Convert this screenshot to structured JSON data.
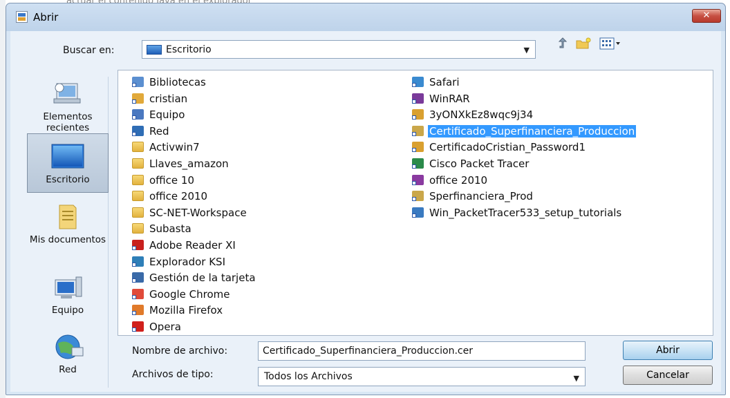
{
  "background": {
    "text": "actuar el contenido Java en el explorador"
  },
  "window": {
    "title": "Abrir",
    "close_label": "✕"
  },
  "toolbar": {
    "lookin_label": "Buscar en:",
    "lookin_value": "Escritorio",
    "up_icon": "up-folder-icon",
    "new_folder_icon": "new-folder-icon",
    "view_icon": "view-menu-icon"
  },
  "places": [
    {
      "label": "Elementos recientes",
      "icon": "recent-items-icon"
    },
    {
      "label": "Escritorio",
      "icon": "desktop-icon",
      "selected": true
    },
    {
      "label": "Mis documentos",
      "icon": "documents-icon"
    },
    {
      "label": "Equipo",
      "icon": "computer-icon"
    },
    {
      "label": "Red",
      "icon": "network-icon"
    }
  ],
  "files_col1": [
    {
      "name": "Bibliotecas",
      "icon": "libraries-icon",
      "color": "#5b8fd0"
    },
    {
      "name": "cristian",
      "icon": "user-folder-icon",
      "color": "#e1a93a"
    },
    {
      "name": "Equipo",
      "icon": "computer-icon",
      "color": "#4a78c0"
    },
    {
      "name": "Red",
      "icon": "network-icon",
      "color": "#2f6db5"
    },
    {
      "name": "Activwin7",
      "icon": "folder-icon",
      "color": "#e8c25a"
    },
    {
      "name": "Llaves_amazon",
      "icon": "folder-icon",
      "color": "#e8c25a"
    },
    {
      "name": "office 10",
      "icon": "folder-icon",
      "color": "#e8c25a"
    },
    {
      "name": "office 2010",
      "icon": "folder-icon",
      "color": "#e8c25a"
    },
    {
      "name": "SC-NET-Workspace",
      "icon": "folder-icon",
      "color": "#e8c25a"
    },
    {
      "name": "Subasta",
      "icon": "folder-icon",
      "color": "#e8c25a"
    },
    {
      "name": "Adobe Reader XI",
      "icon": "adobe-reader-icon",
      "color": "#c8201e"
    },
    {
      "name": "Explorador KSI",
      "icon": "ksi-explorer-icon",
      "color": "#2e7fb8"
    },
    {
      "name": "Gestión de la tarjeta",
      "icon": "card-manager-icon",
      "color": "#3a6aa8"
    },
    {
      "name": "Google Chrome",
      "icon": "chrome-icon",
      "color": "#e04a3a"
    },
    {
      "name": "Mozilla Firefox",
      "icon": "firefox-icon",
      "color": "#e07a2a"
    },
    {
      "name": "Opera",
      "icon": "opera-icon",
      "color": "#d0201c"
    }
  ],
  "files_col2": [
    {
      "name": "Safari",
      "icon": "safari-icon",
      "color": "#3a8ad0"
    },
    {
      "name": "WinRAR",
      "icon": "winrar-icon",
      "color": "#7a3a9a"
    },
    {
      "name": "3yONXkEz8wqc9j34",
      "icon": "certificate-file-icon",
      "color": "#d9a030"
    },
    {
      "name": "Certificado_Superfinanciera_Produccion",
      "icon": "certificate-icon",
      "color": "#caa74a",
      "selected": true
    },
    {
      "name": "CertificadoCristian_Password1",
      "icon": "certificate-file-icon",
      "color": "#d9a030"
    },
    {
      "name": "Cisco Packet Tracer",
      "icon": "cisco-packet-tracer-icon",
      "color": "#2a8a4a"
    },
    {
      "name": "office 2010",
      "icon": "archive-icon",
      "color": "#8a3aa0"
    },
    {
      "name": "Sperfinanciera_Prod",
      "icon": "certificate-icon",
      "color": "#caa74a"
    },
    {
      "name": "Win_PacketTracer533_setup_tutorials",
      "icon": "installer-icon",
      "color": "#3a7ac0"
    }
  ],
  "filename": {
    "label": "Nombre de archivo:",
    "value": "Certificado_Superfinanciera_Produccion.cer"
  },
  "filetype": {
    "label": "Archivos de tipo:",
    "value": "Todos los Archivos"
  },
  "buttons": {
    "open": "Abrir",
    "cancel": "Cancelar"
  },
  "colors": {
    "selection": "#3399ff",
    "frame": "#bed3ea",
    "client": "#eaf1f9"
  }
}
